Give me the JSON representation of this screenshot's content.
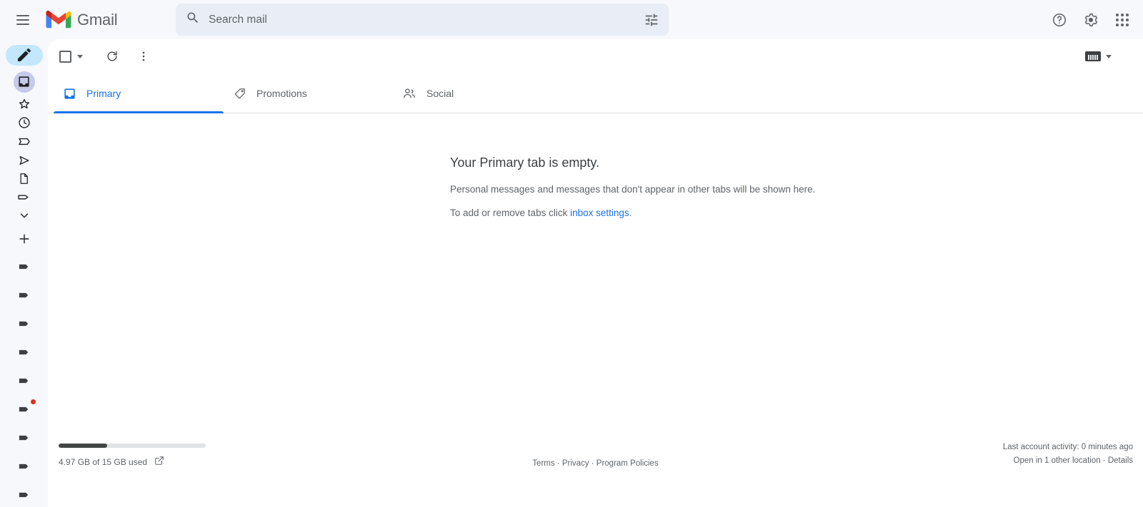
{
  "app": {
    "name": "Gmail",
    "logo_colors": {
      "red": "#ea4335",
      "blue": "#4285f4",
      "green": "#34a853",
      "yellow": "#fbbc04",
      "white": "#ffffff"
    },
    "accent_color": "#1a73e8",
    "header_bg": "#f6f8fc",
    "panel_bg": "#ffffff"
  },
  "header": {
    "menu_icon": "hamburger-menu-icon",
    "brand_label": "Gmail",
    "search": {
      "placeholder": "Search mail",
      "value": "",
      "search_icon": "search-icon",
      "options_icon": "search-options-icon"
    },
    "actions": [
      {
        "name": "support-icon",
        "label": "Support"
      },
      {
        "name": "settings-gear-icon",
        "label": "Settings"
      },
      {
        "name": "google-apps-grid-icon",
        "label": "Google apps"
      }
    ]
  },
  "rail": {
    "compose": {
      "label": "Compose",
      "icon": "pencil-compose-icon",
      "bg": "#c2e7ff"
    },
    "items": [
      {
        "name": "inbox",
        "icon": "inbox-icon",
        "active": true
      },
      {
        "name": "starred",
        "icon": "star-icon",
        "active": false
      },
      {
        "name": "snoozed",
        "icon": "clock-icon",
        "active": false
      },
      {
        "name": "important",
        "icon": "important-bookmark-icon",
        "active": false
      },
      {
        "name": "sent",
        "icon": "send-icon",
        "active": false
      },
      {
        "name": "drafts",
        "icon": "draft-file-icon",
        "active": false
      },
      {
        "name": "categories",
        "icon": "tag-icon",
        "active": false
      },
      {
        "name": "more",
        "icon": "chevron-down-icon",
        "active": false
      }
    ],
    "add": {
      "name": "add-label",
      "icon": "plus-icon"
    },
    "labels": [
      {
        "name": "label-1",
        "icon": "label-icon",
        "badge": false
      },
      {
        "name": "label-2",
        "icon": "label-icon",
        "badge": false
      },
      {
        "name": "label-3",
        "icon": "label-icon",
        "badge": false
      },
      {
        "name": "label-4",
        "icon": "label-icon",
        "badge": false
      },
      {
        "name": "label-5",
        "icon": "label-icon",
        "badge": false
      },
      {
        "name": "label-6",
        "icon": "label-icon",
        "badge": true
      },
      {
        "name": "label-7",
        "icon": "label-icon",
        "badge": false
      },
      {
        "name": "label-8",
        "icon": "label-icon",
        "badge": false
      },
      {
        "name": "label-9",
        "icon": "label-icon",
        "badge": false
      }
    ],
    "badge_color": "#d93025"
  },
  "toolbar": {
    "select_all": {
      "name": "select-all-checkbox",
      "icon": "checkbox-icon",
      "caret": "chevron-down-icon"
    },
    "refresh": {
      "name": "refresh-button",
      "icon": "refresh-icon"
    },
    "more": {
      "name": "more-options-button",
      "icon": "more-vertical-icon"
    },
    "input_method": {
      "name": "input-method-indicator",
      "icon": "keyboard-icon",
      "caret": "chevron-down-icon"
    }
  },
  "tabs": [
    {
      "label": "Primary",
      "icon": "inbox-icon",
      "active": true
    },
    {
      "label": "Promotions",
      "icon": "tag-icon",
      "active": false
    },
    {
      "label": "Social",
      "icon": "people-icon",
      "active": false
    }
  ],
  "empty_state": {
    "title": "Your Primary tab is empty.",
    "description": "Personal messages and messages that don't appear in other tabs will be shown here.",
    "hint_prefix": "To add or remove tabs click ",
    "hint_link": "inbox settings",
    "hint_suffix": "."
  },
  "footer": {
    "storage": {
      "used_text": "4.97 GB of 15 GB used",
      "percent": 33,
      "external_icon": "external-link-icon"
    },
    "links": [
      {
        "label": "Terms"
      },
      {
        "label": "Privacy"
      },
      {
        "label": "Program Policies"
      }
    ],
    "separator": " · ",
    "activity_line1": "Last account activity: 0 minutes ago",
    "activity_prefix": "Open in 1 other location · ",
    "activity_link": "Details"
  }
}
